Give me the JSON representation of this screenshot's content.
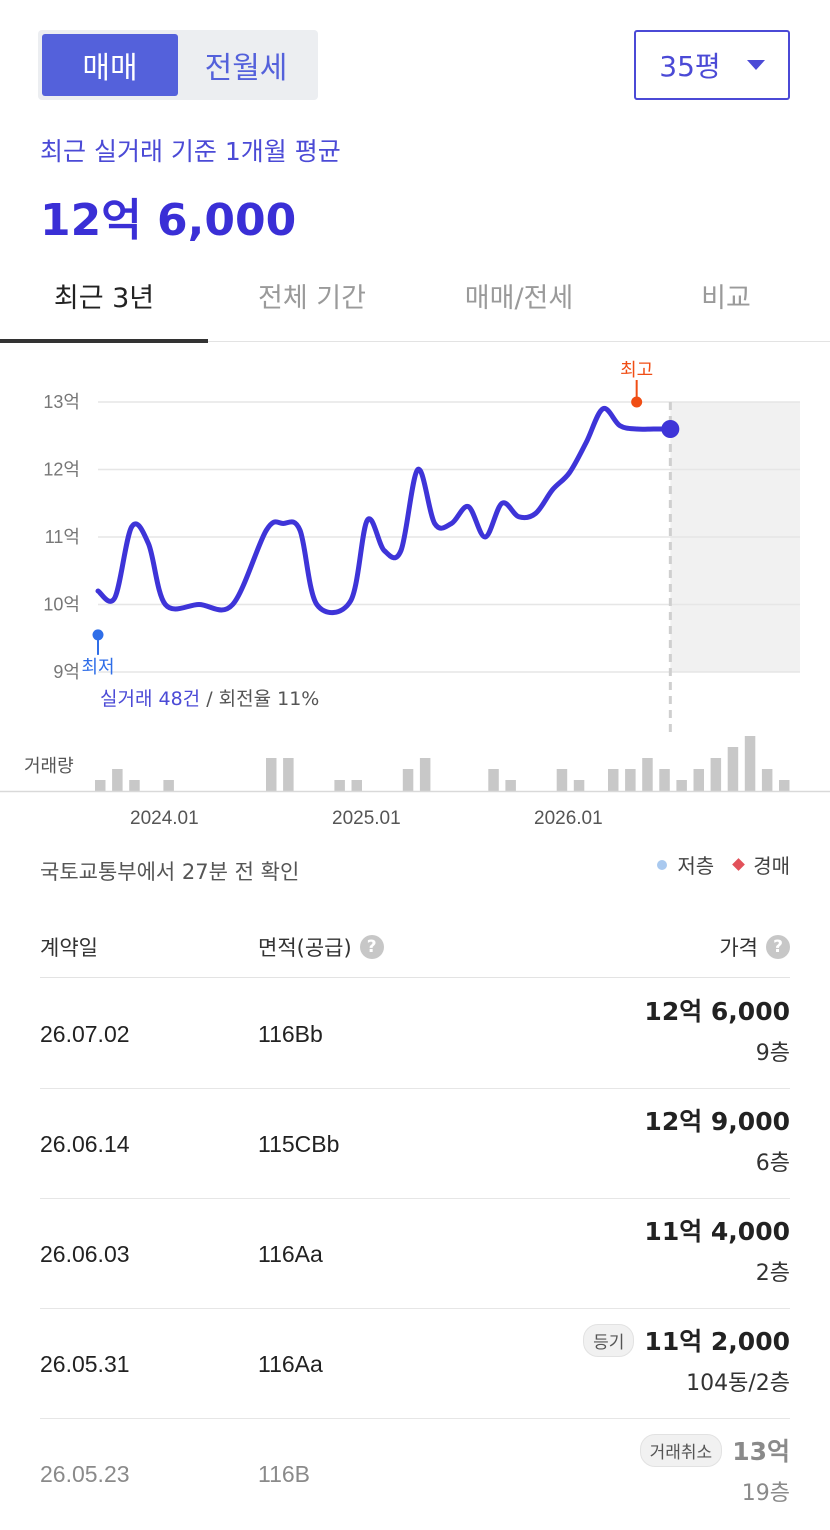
{
  "trade_toggle": {
    "active": "매매",
    "inactive": "전월세"
  },
  "size_select": {
    "value": "35평"
  },
  "summary": {
    "label": "최근 실거래 기준 1개월 평균",
    "value": "12억 6,000"
  },
  "period_tabs": [
    "최근 3년",
    "전체 기간",
    "매매/전세",
    "비교"
  ],
  "chart_data": {
    "type": "line",
    "ylim": [
      9,
      13
    ],
    "y_ticks": [
      "13억",
      "12억",
      "11억",
      "10억",
      "9억"
    ],
    "x_ticks": [
      "2024.01",
      "2025.01",
      "2026.01"
    ],
    "series": [
      {
        "x": [
          "2023.09",
          "2023.10",
          "2023.11",
          "2023.12",
          "2024.01",
          "2024.03",
          "2024.05",
          "2024.07",
          "2024.08",
          "2024.09",
          "2024.10",
          "2024.12",
          "2025.01",
          "2025.02",
          "2025.03",
          "2025.04",
          "2025.05",
          "2025.06",
          "2025.07",
          "2025.08",
          "2025.09",
          "2025.10",
          "2025.11",
          "2025.12",
          "2026.01",
          "2026.02",
          "2026.03",
          "2026.04",
          "2026.05",
          "2026.06",
          "2026.07"
        ],
        "values": [
          10.2,
          10.1,
          11.15,
          10.9,
          10.0,
          10.0,
          10.0,
          11.1,
          11.2,
          11.1,
          10.0,
          10.05,
          11.25,
          10.8,
          10.8,
          12.0,
          11.2,
          11.2,
          11.45,
          11.0,
          11.5,
          11.3,
          11.35,
          11.7,
          11.95,
          12.4,
          12.9,
          12.65,
          12.6,
          12.6,
          12.6
        ]
      }
    ],
    "markers": {
      "high_label": "최고",
      "low_label": "최저",
      "high": 13.0,
      "low": 9.55
    },
    "summary_count": "실거래 48건",
    "summary_turnover": "/ 회전율 11%",
    "volume_label": "거래량",
    "volume": [
      1,
      2,
      1,
      0,
      1,
      0,
      0,
      0,
      0,
      0,
      3,
      3,
      0,
      0,
      1,
      1,
      0,
      0,
      2,
      3,
      0,
      0,
      0,
      2,
      1,
      0,
      0,
      2,
      1,
      0,
      2,
      2,
      3,
      2,
      1,
      2,
      3,
      4,
      5,
      2,
      1
    ]
  },
  "source_note": "국토교통부에서 27분 전 확인",
  "legend": {
    "low_floor": "저층",
    "auction": "경매"
  },
  "table": {
    "headers": {
      "date": "계약일",
      "area": "면적(공급)",
      "price": "가격"
    },
    "rows": [
      {
        "date": "26.07.02",
        "area": "116Bb",
        "price": "12억 6,000",
        "floor": "9층",
        "badge": ""
      },
      {
        "date": "26.06.14",
        "area": "115CBb",
        "price": "12억 9,000",
        "floor": "6층",
        "badge": ""
      },
      {
        "date": "26.06.03",
        "area": "116Aa",
        "price": "11억 4,000",
        "floor": "2층",
        "badge": ""
      },
      {
        "date": "26.05.31",
        "area": "116Aa",
        "price": "11억 2,000",
        "floor": "104동/2층",
        "badge": "등기"
      },
      {
        "date": "26.05.23",
        "area": "116B",
        "price": "13억",
        "floor": "19층",
        "badge": "거래취소"
      }
    ]
  },
  "colors": {
    "accent": "#4b4ad6",
    "line": "#3e34d8",
    "high": "#f04d14",
    "low": "#2f6ee8",
    "low_floor": "#a9c9ef",
    "auction": "#e2515a"
  }
}
